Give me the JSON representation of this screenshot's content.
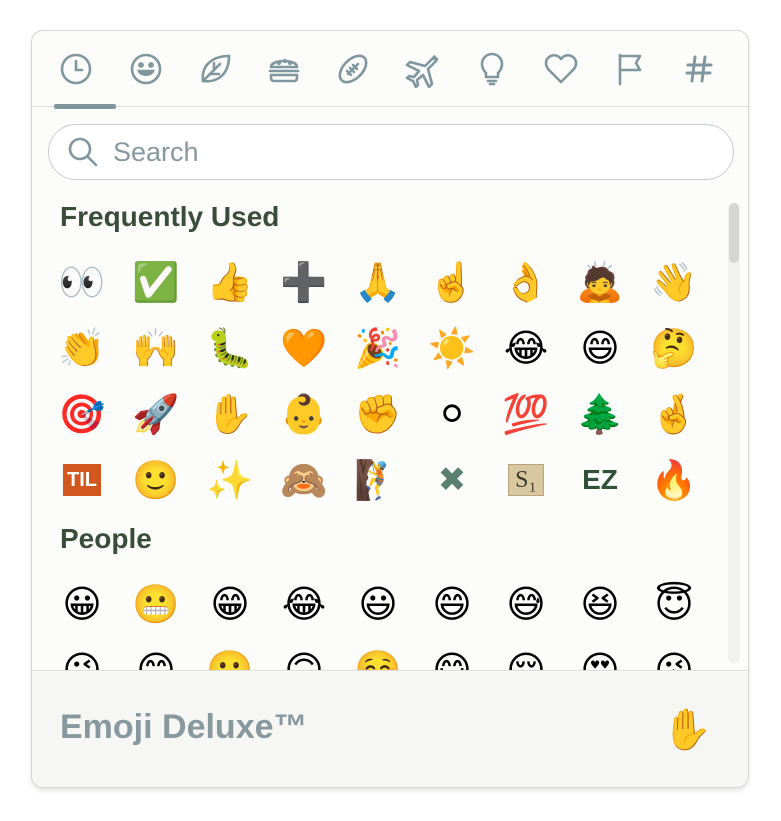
{
  "tabs": [
    {
      "name": "recent",
      "icon": "clock-icon"
    },
    {
      "name": "people",
      "icon": "smiley-icon"
    },
    {
      "name": "nature",
      "icon": "leaf-icon"
    },
    {
      "name": "food",
      "icon": "burger-icon"
    },
    {
      "name": "activity",
      "icon": "football-icon"
    },
    {
      "name": "travel",
      "icon": "airplane-icon"
    },
    {
      "name": "objects",
      "icon": "lightbulb-icon"
    },
    {
      "name": "symbols",
      "icon": "heart-icon"
    },
    {
      "name": "flags",
      "icon": "flag-icon"
    },
    {
      "name": "custom",
      "icon": "hash-icon"
    }
  ],
  "active_tab_index": 0,
  "search": {
    "placeholder": "Search",
    "value": ""
  },
  "sections": [
    {
      "title": "Frequently Used",
      "emojis": [
        "👀",
        "✅",
        "👍",
        "➕",
        "🙏",
        "☝️",
        "👌",
        "🙇",
        "👋",
        "👏",
        "🙌",
        "🐛",
        "🧡",
        "🎉",
        "☀️",
        "😂",
        "😄",
        "🤔",
        "🎯",
        "🚀",
        "✋",
        "👶",
        "✊",
        "⚪",
        "💯",
        "🌲",
        "🤞",
        "TIL",
        "🙂",
        "✨",
        "🙈",
        "🧗",
        "✖",
        "S₁",
        "EZ",
        "🔥"
      ]
    },
    {
      "title": "People",
      "emojis": [
        "😀",
        "😬",
        "😁",
        "😂",
        "😃",
        "😄",
        "😅",
        "😆",
        "😇",
        "😉",
        "😊",
        "🙂",
        "🙃",
        "☺️",
        "😋",
        "😌",
        "😍",
        "😘"
      ]
    }
  ],
  "footer": {
    "title": "Emoji Deluxe™",
    "skin_tone_emoji": "✋"
  },
  "colors": {
    "icon": "#80979f",
    "heading": "#3a4d3a",
    "footer_text": "#87989f",
    "border": "#d6d6d2"
  }
}
